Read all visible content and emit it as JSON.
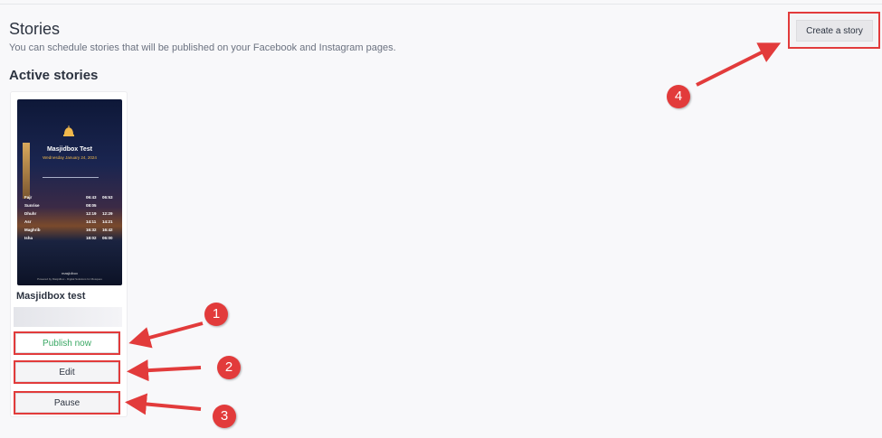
{
  "page": {
    "title": "Stories",
    "subtitle": "You can schedule stories that will be published on your Facebook and Instagram pages.",
    "section_title": "Active stories",
    "create_label": "Create a story"
  },
  "story": {
    "name": "Masjidbox test",
    "publish_label": "Publish now",
    "edit_label": "Edit",
    "pause_label": "Pause",
    "thumbnail": {
      "title": "Masjidbox Test",
      "date": "Wednesday January 24, 2024",
      "rows": [
        {
          "name": "Fajr",
          "t1": "06:43",
          "t2": "06:53"
        },
        {
          "name": "Sunrise",
          "t1": "08:05",
          "t2": ""
        },
        {
          "name": "Dhuhr",
          "t1": "12:19",
          "t2": "12:29"
        },
        {
          "name": "Asr",
          "t1": "14:11",
          "t2": "14:21"
        },
        {
          "name": "Maghrib",
          "t1": "16:32",
          "t2": "16:42"
        },
        {
          "name": "Isha",
          "t1": "18:02",
          "t2": "06:00"
        }
      ],
      "brand": "masjidbox",
      "tagline": "Powered by Masjidbox - Digital Solutions for Mosques"
    }
  },
  "annotations": {
    "badge_1": "1",
    "badge_2": "2",
    "badge_3": "3",
    "badge_4": "4",
    "color": "#e23b3b"
  }
}
